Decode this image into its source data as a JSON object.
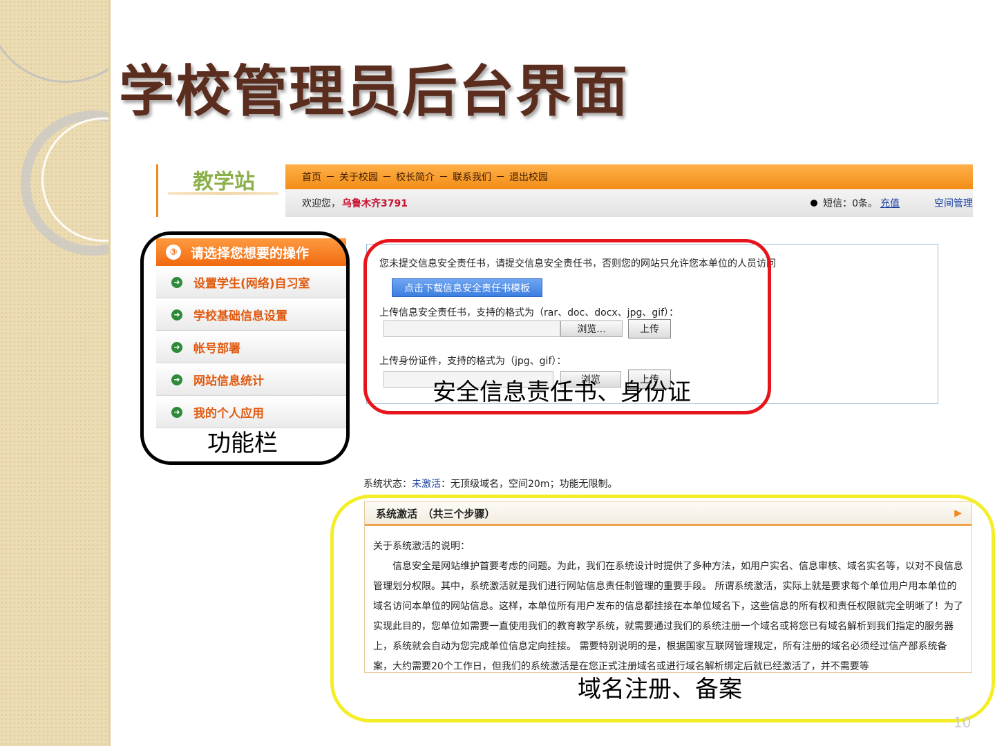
{
  "slide": {
    "title": "学校管理员后台界面",
    "page_number": "10"
  },
  "site": {
    "brand": "教学站",
    "nav": [
      "首页",
      "关于校园",
      "校长简介",
      "联系我们",
      "退出校园"
    ],
    "nav_separator": "－",
    "welcome_prefix": "欢迎您，",
    "username": "乌鲁木齐3791",
    "sms_label": "短信：",
    "sms_count": "0条。",
    "recharge_link": "充值",
    "space_manage": "空间管理"
  },
  "menu": {
    "header": "请选择您想要的操作",
    "items": [
      "设置学生(网络)自习室",
      "学校基础信息设置",
      "帐号部署",
      "网站信息统计",
      "我的个人应用"
    ],
    "caption": "功能栏"
  },
  "upload": {
    "notice": "您未提交信息安全责任书，请提交信息安全责任书，否则您的网站只允许您本单位的人员访问",
    "download_button": "点击下载信息安全责任书模板",
    "label_responsibility": "上传信息安全责任书，支持的格式为（rar、doc、docx、jpg、gif）：",
    "browse_label": "浏览...",
    "upload_label": "上传",
    "label_id": "上传身份证件，支持的格式为（jpg、gif）：",
    "browse_label_2": "浏览",
    "upload_label_2": "上传",
    "caption": "安全信息责任书、身份证"
  },
  "system": {
    "status_prefix": "系统状态：",
    "status_value": "未激活",
    "status_suffix": "：无顶级域名，空间20m；功能无限制。",
    "activation_title": "系统激活　（共三个步骤）",
    "explain_title": "关于系统激活的说明：",
    "explain_text": "信息安全是网站维护首要考虑的问题。为此，我们在系统设计时提供了多种方法，如用户实名、信息审核、域名实名等，以对不良信息管理划分权限。其中，系统激活就是我们进行网站信息责任制管理的重要手段。 所谓系统激活，实际上就是要求每个单位用户用本单位的域名访问本单位的网站信息。这样，本单位所有用户发布的信息都挂接在本单位域名下，这些信息的所有权和责任权限就完全明晰了！为了实现此目的，您单位如需要一直使用我们的教育教学系统，就需要通过我们的系统注册一个域名或将您已有域名解析到我们指定的服务器上，系统就会自动为您完成单位信息定向挂接。 需要特别说明的是，根据国家互联网管理规定，所有注册的域名必须经过信产部系统备案，大约需要20个工作日，但我们的系统激活是在您正式注册域名或进行域名解析绑定后就已经激活了，并不需要等",
    "caption": "域名注册、备案"
  },
  "colors": {
    "accent_orange": "#f28d16",
    "title_brown": "#5a2d1e",
    "red_highlight": "#e8141c",
    "yellow_highlight": "#f4ee28",
    "menu_text": "#e05a10"
  },
  "icons": {
    "menu_header": "circle-3-icon",
    "menu_item": "arrow-circle-icon",
    "sms": "bullet-dot-icon",
    "expand": "triangle-right-icon"
  }
}
